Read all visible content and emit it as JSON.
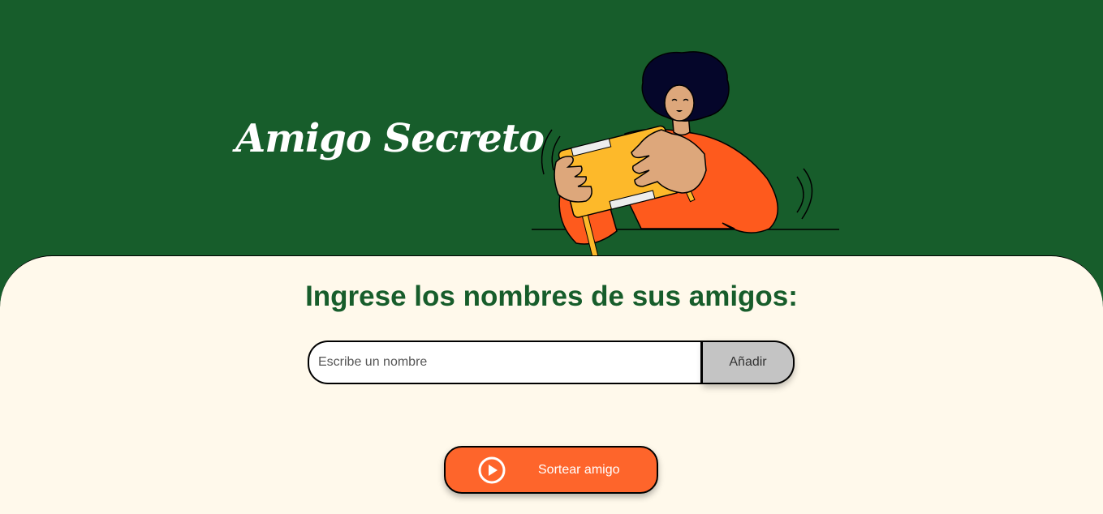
{
  "header": {
    "title": "Amigo Secreto"
  },
  "main": {
    "section_title": "Ingrese los nombres de sus amigos:",
    "name_input": {
      "placeholder": "Escribe un nombre",
      "value": ""
    },
    "add_button_label": "Añadir",
    "draw_button_label": "Sortear amigo"
  },
  "icons": {
    "draw_button_icon": "play-circle-icon",
    "illustration": "person-opening-gift-illustration"
  },
  "colors": {
    "header_background": "#175D2B",
    "main_background": "#FFF9EB",
    "title_text": "#FFFFFF",
    "section_title": "#175D2B",
    "add_button": "#C4C4C4",
    "draw_button": "#FE652B"
  }
}
